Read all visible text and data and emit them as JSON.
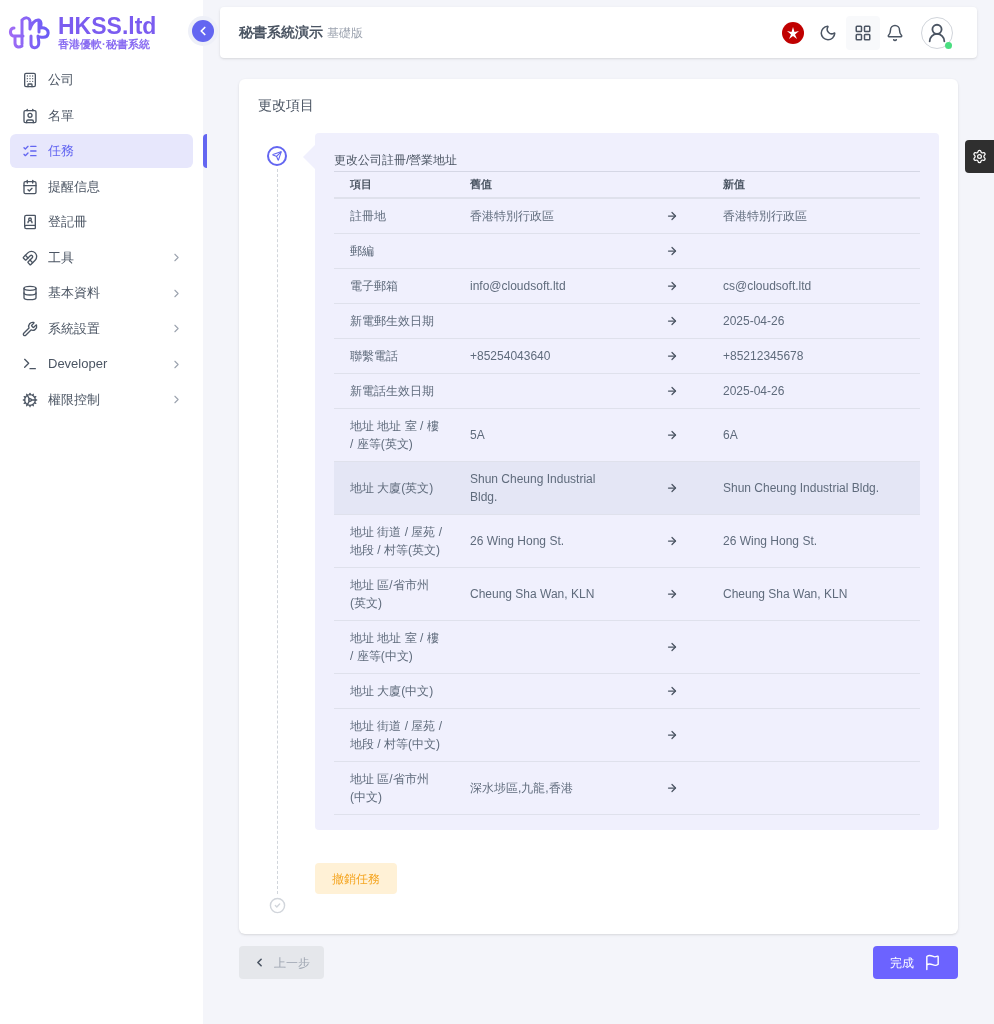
{
  "brand": {
    "name": "HKSS.ltd",
    "tagline": "香港優軟·秘書系統"
  },
  "sidebar": {
    "items": [
      {
        "label": "公司",
        "selected": false,
        "expandable": false
      },
      {
        "label": "名單",
        "selected": false,
        "expandable": false
      },
      {
        "label": "任務",
        "selected": true,
        "expandable": false
      },
      {
        "label": "提醒信息",
        "selected": false,
        "expandable": false
      },
      {
        "label": "登記冊",
        "selected": false,
        "expandable": false
      },
      {
        "label": "工具",
        "selected": false,
        "expandable": true
      },
      {
        "label": "基本資料",
        "selected": false,
        "expandable": true
      },
      {
        "label": "系統設置",
        "selected": false,
        "expandable": true
      },
      {
        "label": "Developer",
        "selected": false,
        "expandable": true
      },
      {
        "label": "權限控制",
        "selected": false,
        "expandable": true
      }
    ]
  },
  "header": {
    "title": "秘書系統演示",
    "edition": "基礎版",
    "user_online": true
  },
  "card": {
    "title": "更改項目",
    "step": {
      "title": "更改公司註冊/營業地址",
      "columns": [
        "項目",
        "舊值",
        "新值"
      ],
      "rows": [
        {
          "item": "註冊地",
          "old": "香港特別行政區",
          "new": "香港特別行政區",
          "selected": false
        },
        {
          "item": "郵編",
          "selected": false
        },
        {
          "item": "電子郵箱",
          "old": "info@cloudsoft.ltd",
          "new": "cs@cloudsoft.ltd",
          "selected": false
        },
        {
          "item": "新電郵生效日期",
          "new": "2025-04-26",
          "selected": false
        },
        {
          "item": "聯繫電話",
          "old": "+85254043640",
          "new": "+85212345678",
          "selected": false
        },
        {
          "item": "新電話生效日期",
          "new": "2025-04-26",
          "selected": false
        },
        {
          "item": "地址 地址 室 / 樓 / 座等(英文)",
          "old": "5A",
          "new": "6A",
          "selected": false
        },
        {
          "item": "地址 大廈(英文)",
          "old": "Shun Cheung Industrial Bldg.",
          "new": "Shun Cheung Industrial Bldg.",
          "selected": true
        },
        {
          "item": "地址 街道 / 屋苑 / 地段 / 村等(英文)",
          "old": "26 Wing Hong St.",
          "new": "26 Wing Hong St.",
          "selected": false
        },
        {
          "item": "地址 區/省市州 (英文)",
          "old": "Cheung Sha Wan, KLN",
          "new": "Cheung Sha Wan, KLN",
          "selected": false
        },
        {
          "item": "地址 地址 室 / 樓 / 座等(中文)",
          "selected": false
        },
        {
          "item": "地址 大廈(中文)",
          "selected": false
        },
        {
          "item": "地址 街道 / 屋苑 / 地段 / 村等(中文)",
          "selected": false
        },
        {
          "item": "地址 區/省市州 (中文)",
          "old": "深水埗區,九龍,香港",
          "selected": false
        }
      ]
    },
    "cancel_button": "撤銷任務"
  },
  "footer": {
    "back_button": "上一步",
    "finish_button": "完成"
  }
}
